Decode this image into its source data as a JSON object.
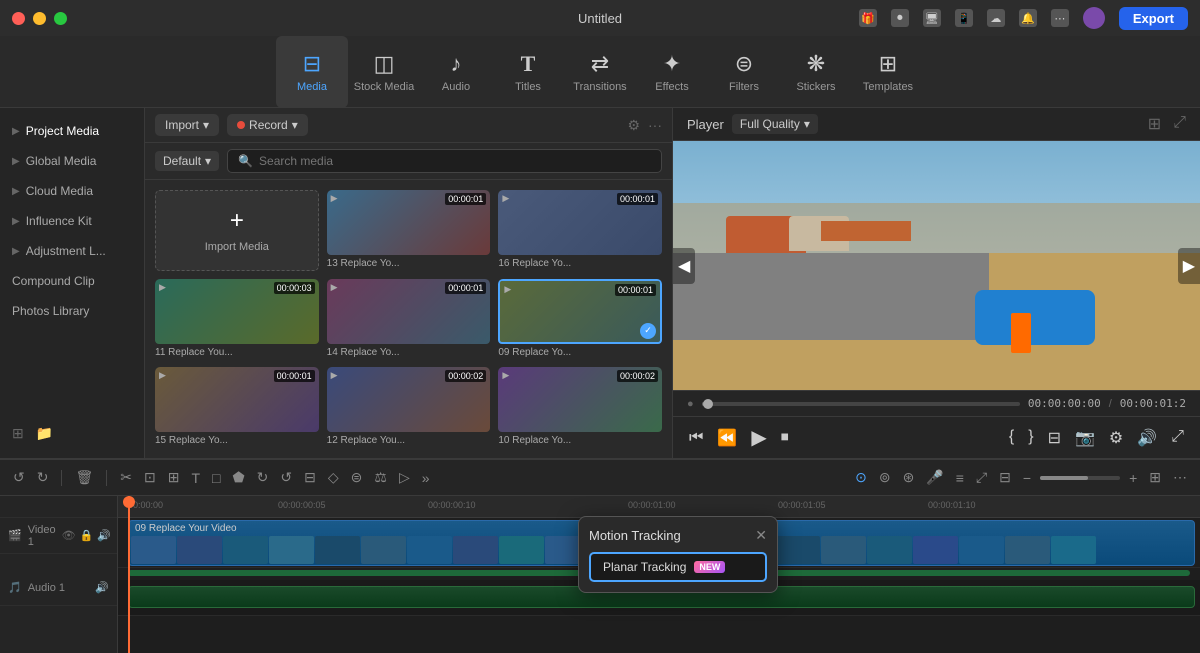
{
  "titlebar": {
    "title": "Untitled",
    "export_label": "Export"
  },
  "toolbar": {
    "items": [
      {
        "id": "media",
        "label": "Media",
        "icon": "🖼",
        "active": true
      },
      {
        "id": "stock",
        "label": "Stock Media",
        "icon": "📦",
        "active": false
      },
      {
        "id": "audio",
        "label": "Audio",
        "icon": "🎵",
        "active": false
      },
      {
        "id": "titles",
        "label": "Titles",
        "icon": "T",
        "active": false
      },
      {
        "id": "transitions",
        "label": "Transitions",
        "icon": "↔",
        "active": false
      },
      {
        "id": "effects",
        "label": "Effects",
        "icon": "✨",
        "active": false
      },
      {
        "id": "filters",
        "label": "Filters",
        "icon": "🎨",
        "active": false
      },
      {
        "id": "stickers",
        "label": "Stickers",
        "icon": "⭐",
        "active": false
      },
      {
        "id": "templates",
        "label": "Templates",
        "icon": "⊞",
        "active": false
      }
    ]
  },
  "sidebar": {
    "items": [
      {
        "id": "project-media",
        "label": "Project Media",
        "active": true
      },
      {
        "id": "global-media",
        "label": "Global Media",
        "active": false
      },
      {
        "id": "cloud-media",
        "label": "Cloud Media",
        "active": false
      },
      {
        "id": "influence-kit",
        "label": "Influence Kit",
        "active": false
      },
      {
        "id": "adjustment-l",
        "label": "Adjustment L...",
        "active": false
      },
      {
        "id": "compound-clip",
        "label": "Compound Clip",
        "active": false
      },
      {
        "id": "photos-library",
        "label": "Photos Library",
        "active": false
      }
    ]
  },
  "media_panel": {
    "import_label": "Import",
    "record_label": "Record",
    "default_label": "Default",
    "search_placeholder": "Search media",
    "import_media_label": "Import Media",
    "media_items": [
      {
        "id": "m1",
        "time": "00:00:01",
        "label": "13 Replace Yo...",
        "color": "t1",
        "checked": false
      },
      {
        "id": "m2",
        "time": "00:00:01",
        "label": "16 Replace Yo...",
        "color": "t2",
        "checked": false
      },
      {
        "id": "m3",
        "time": "00:00:03",
        "label": "11 Replace You...",
        "color": "t3",
        "checked": false
      },
      {
        "id": "m4",
        "time": "00:00:01",
        "label": "14 Replace Yo...",
        "color": "t4",
        "checked": false
      },
      {
        "id": "m5",
        "time": "00:00:01",
        "label": "09 Replace Yo...",
        "color": "t5",
        "checked": true
      },
      {
        "id": "m6",
        "time": "00:00:01",
        "label": "15 Replace Yo...",
        "color": "t6",
        "checked": false
      },
      {
        "id": "m7",
        "time": "00:00:02",
        "label": "12 Replace You...",
        "color": "t7",
        "checked": false
      },
      {
        "id": "m8",
        "time": "00:00:02",
        "label": "10 Replace Yo...",
        "color": "t8",
        "checked": false
      }
    ]
  },
  "preview": {
    "label": "Player",
    "quality": "Full Quality",
    "time_current": "00:00:00:00",
    "time_total": "00:00:01:2"
  },
  "timeline": {
    "markers": [
      "00:00:00",
      "00:00:00:05",
      "00:00:00:10",
      "00:00:01:00",
      "00:00:01:05",
      "00:00:01:10"
    ],
    "video_track_label": "Video 1",
    "audio_track_label": "Audio 1",
    "video_clip_label": "09 Replace Your Video",
    "zoom_level": "60"
  },
  "motion_tracking": {
    "title": "Motion Tracking",
    "planar_label": "Planar Tracking",
    "badge": "NEW"
  }
}
